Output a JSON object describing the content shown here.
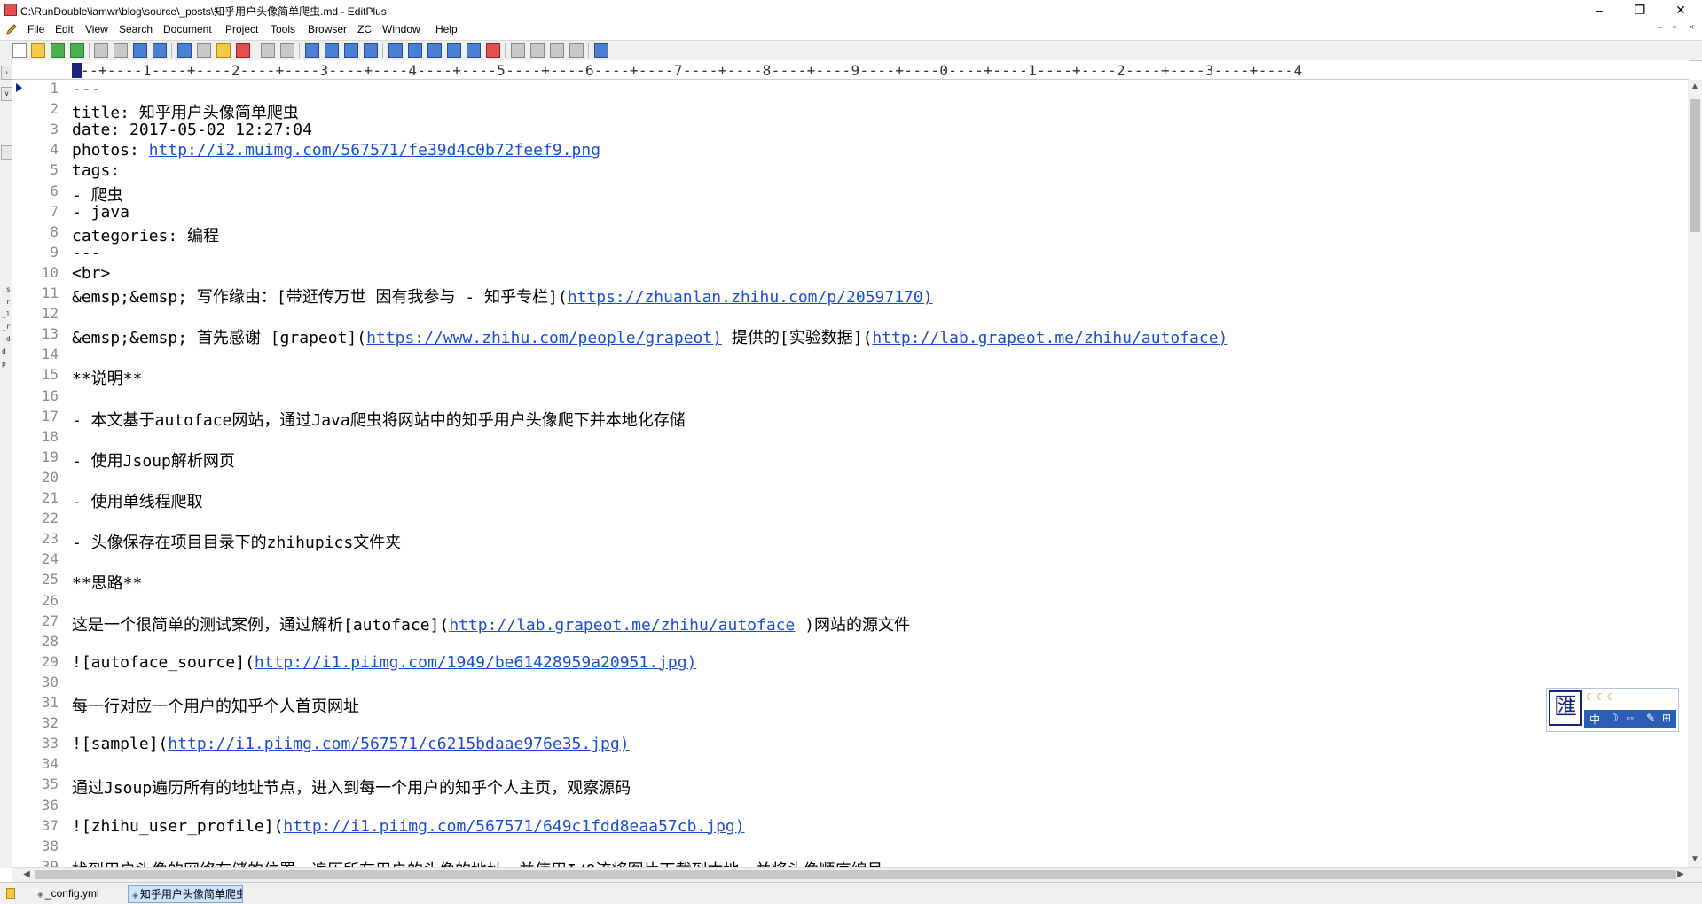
{
  "window": {
    "title": "C:\\RunDouble\\iamwr\\blog\\source\\_posts\\知乎用户头像简单爬虫.md - EditPlus",
    "minimize": "–",
    "restore": "❐",
    "close": "✕"
  },
  "menu": [
    "File",
    "Edit",
    "View",
    "Search",
    "Document",
    "Project",
    "Tools",
    "Browser",
    "ZC",
    "Window",
    "Help"
  ],
  "mdi_controls": [
    "–",
    "▫",
    "×"
  ],
  "toolbar": {
    "icons": [
      "new-file-icon",
      "open-file-icon",
      "save-icon",
      "save-all-icon",
      "print-preview-icon",
      "print-icon",
      "spellcheck-icon",
      "browser-icon",
      "cut-icon",
      "copy-icon",
      "paste-icon",
      "delete-icon",
      "undo-icon",
      "redo-icon",
      "find-icon",
      "replace-icon",
      "find-in-files-icon",
      "goto-icon",
      "font-icon",
      "heading-icon",
      "word-wrap-icon",
      "line-number-icon",
      "ruler-icon",
      "check-icon",
      "cliptext-icon",
      "directory-icon",
      "output-icon",
      "fullscreen-icon",
      "help-icon"
    ]
  },
  "ruler": {
    "text": "---+----1----+----2----+----3----+----4----+----5----+----6----+----7----+----8----+----9----+----0----+----1----+----2----+----3----+----4"
  },
  "left_strip": {
    "labels": [
      ":s",
      ".r",
      "_l",
      "_r",
      ".d",
      "d",
      "p"
    ]
  },
  "editor": {
    "lines": [
      {
        "n": "1",
        "parts": [
          {
            "t": "---"
          }
        ]
      },
      {
        "n": "2",
        "parts": [
          {
            "t": "title: 知乎用户头像简单爬虫"
          }
        ]
      },
      {
        "n": "3",
        "parts": [
          {
            "t": "date: 2017-05-02 12:27:04"
          }
        ]
      },
      {
        "n": "4",
        "parts": [
          {
            "t": "photos: "
          },
          {
            "t": "http://i2.muimg.com/567571/fe39d4c0b72feef9.png",
            "link": true
          }
        ]
      },
      {
        "n": "5",
        "parts": [
          {
            "t": "tags:"
          }
        ]
      },
      {
        "n": "6",
        "parts": [
          {
            "t": "- 爬虫"
          }
        ]
      },
      {
        "n": "7",
        "parts": [
          {
            "t": "- java"
          }
        ]
      },
      {
        "n": "8",
        "parts": [
          {
            "t": "categories: 编程"
          }
        ]
      },
      {
        "n": "9",
        "parts": [
          {
            "t": "---"
          }
        ]
      },
      {
        "n": "10",
        "parts": [
          {
            "t": "<br>"
          }
        ]
      },
      {
        "n": "11",
        "parts": [
          {
            "t": "&emsp;&emsp; 写作缘由：[带逛传万世 因有我参与 - 知乎专栏]("
          },
          {
            "t": "https://zhuanlan.zhihu.com/p/20597170)",
            "link": true
          }
        ]
      },
      {
        "n": "12",
        "parts": [
          {
            "t": ""
          }
        ]
      },
      {
        "n": "13",
        "parts": [
          {
            "t": "&emsp;&emsp; 首先感谢 [grapeot]("
          },
          {
            "t": "https://www.zhihu.com/people/grapeot)",
            "link": true
          },
          {
            "t": " 提供的[实验数据]("
          },
          {
            "t": "http://lab.grapeot.me/zhihu/autoface)",
            "link": true
          }
        ]
      },
      {
        "n": "14",
        "parts": [
          {
            "t": ""
          }
        ]
      },
      {
        "n": "15",
        "parts": [
          {
            "t": "**说明**"
          }
        ]
      },
      {
        "n": "16",
        "parts": [
          {
            "t": ""
          }
        ]
      },
      {
        "n": "17",
        "parts": [
          {
            "t": "- 本文基于autoface网站，通过Java爬虫将网站中的知乎用户头像爬下并本地化存储"
          }
        ]
      },
      {
        "n": "18",
        "parts": [
          {
            "t": ""
          }
        ]
      },
      {
        "n": "19",
        "parts": [
          {
            "t": "- 使用Jsoup解析网页"
          }
        ]
      },
      {
        "n": "20",
        "parts": [
          {
            "t": ""
          }
        ]
      },
      {
        "n": "21",
        "parts": [
          {
            "t": "- 使用单线程爬取"
          }
        ]
      },
      {
        "n": "22",
        "parts": [
          {
            "t": ""
          }
        ]
      },
      {
        "n": "23",
        "parts": [
          {
            "t": "- 头像保存在项目目录下的zhihupics文件夹"
          }
        ]
      },
      {
        "n": "24",
        "parts": [
          {
            "t": ""
          }
        ]
      },
      {
        "n": "25",
        "parts": [
          {
            "t": "**思路**"
          }
        ]
      },
      {
        "n": "26",
        "parts": [
          {
            "t": ""
          }
        ]
      },
      {
        "n": "27",
        "parts": [
          {
            "t": "这是一个很简单的测试案例，通过解析[autoface]("
          },
          {
            "t": "http://lab.grapeot.me/zhihu/autoface",
            "link": true
          },
          {
            "t": " )网站的源文件"
          }
        ]
      },
      {
        "n": "28",
        "parts": [
          {
            "t": ""
          }
        ]
      },
      {
        "n": "29",
        "parts": [
          {
            "t": "![autoface_source]("
          },
          {
            "t": "http://i1.piimg.com/1949/be61428959a20951.jpg)",
            "link": true
          }
        ]
      },
      {
        "n": "30",
        "parts": [
          {
            "t": ""
          }
        ]
      },
      {
        "n": "31",
        "parts": [
          {
            "t": "每一行对应一个用户的知乎个人首页网址"
          }
        ]
      },
      {
        "n": "32",
        "parts": [
          {
            "t": ""
          }
        ]
      },
      {
        "n": "33",
        "parts": [
          {
            "t": "![sample]("
          },
          {
            "t": "http://i1.piimg.com/567571/c6215bdaae976e35.jpg)",
            "link": true
          }
        ]
      },
      {
        "n": "34",
        "parts": [
          {
            "t": ""
          }
        ]
      },
      {
        "n": "35",
        "parts": [
          {
            "t": "通过Jsoup遍历所有的地址节点，进入到每一个用户的知乎个人主页，观察源码"
          }
        ]
      },
      {
        "n": "36",
        "parts": [
          {
            "t": ""
          }
        ]
      },
      {
        "n": "37",
        "parts": [
          {
            "t": "![zhihu_user_profile]("
          },
          {
            "t": "http://i1.piimg.com/567571/649c1fdd8eaa57cb.jpg)",
            "link": true
          }
        ]
      },
      {
        "n": "38",
        "parts": [
          {
            "t": ""
          }
        ]
      },
      {
        "n": "39",
        "parts": [
          {
            "t": "找到用户头像的网络存储的位置，遍历所有用户的头像的地址，并使用I/O流将图片下载到本地，并将头像顺序编号"
          }
        ]
      }
    ]
  },
  "tabs": [
    {
      "label": "_config.yml",
      "active": false
    },
    {
      "label": "知乎用户头像简单爬虫.md",
      "active": true
    }
  ],
  "ime": {
    "logo": "匯",
    "moons": "☾☾☾",
    "items": [
      "中",
      "☽",
      "◦◦",
      "✎",
      "⊞"
    ]
  }
}
